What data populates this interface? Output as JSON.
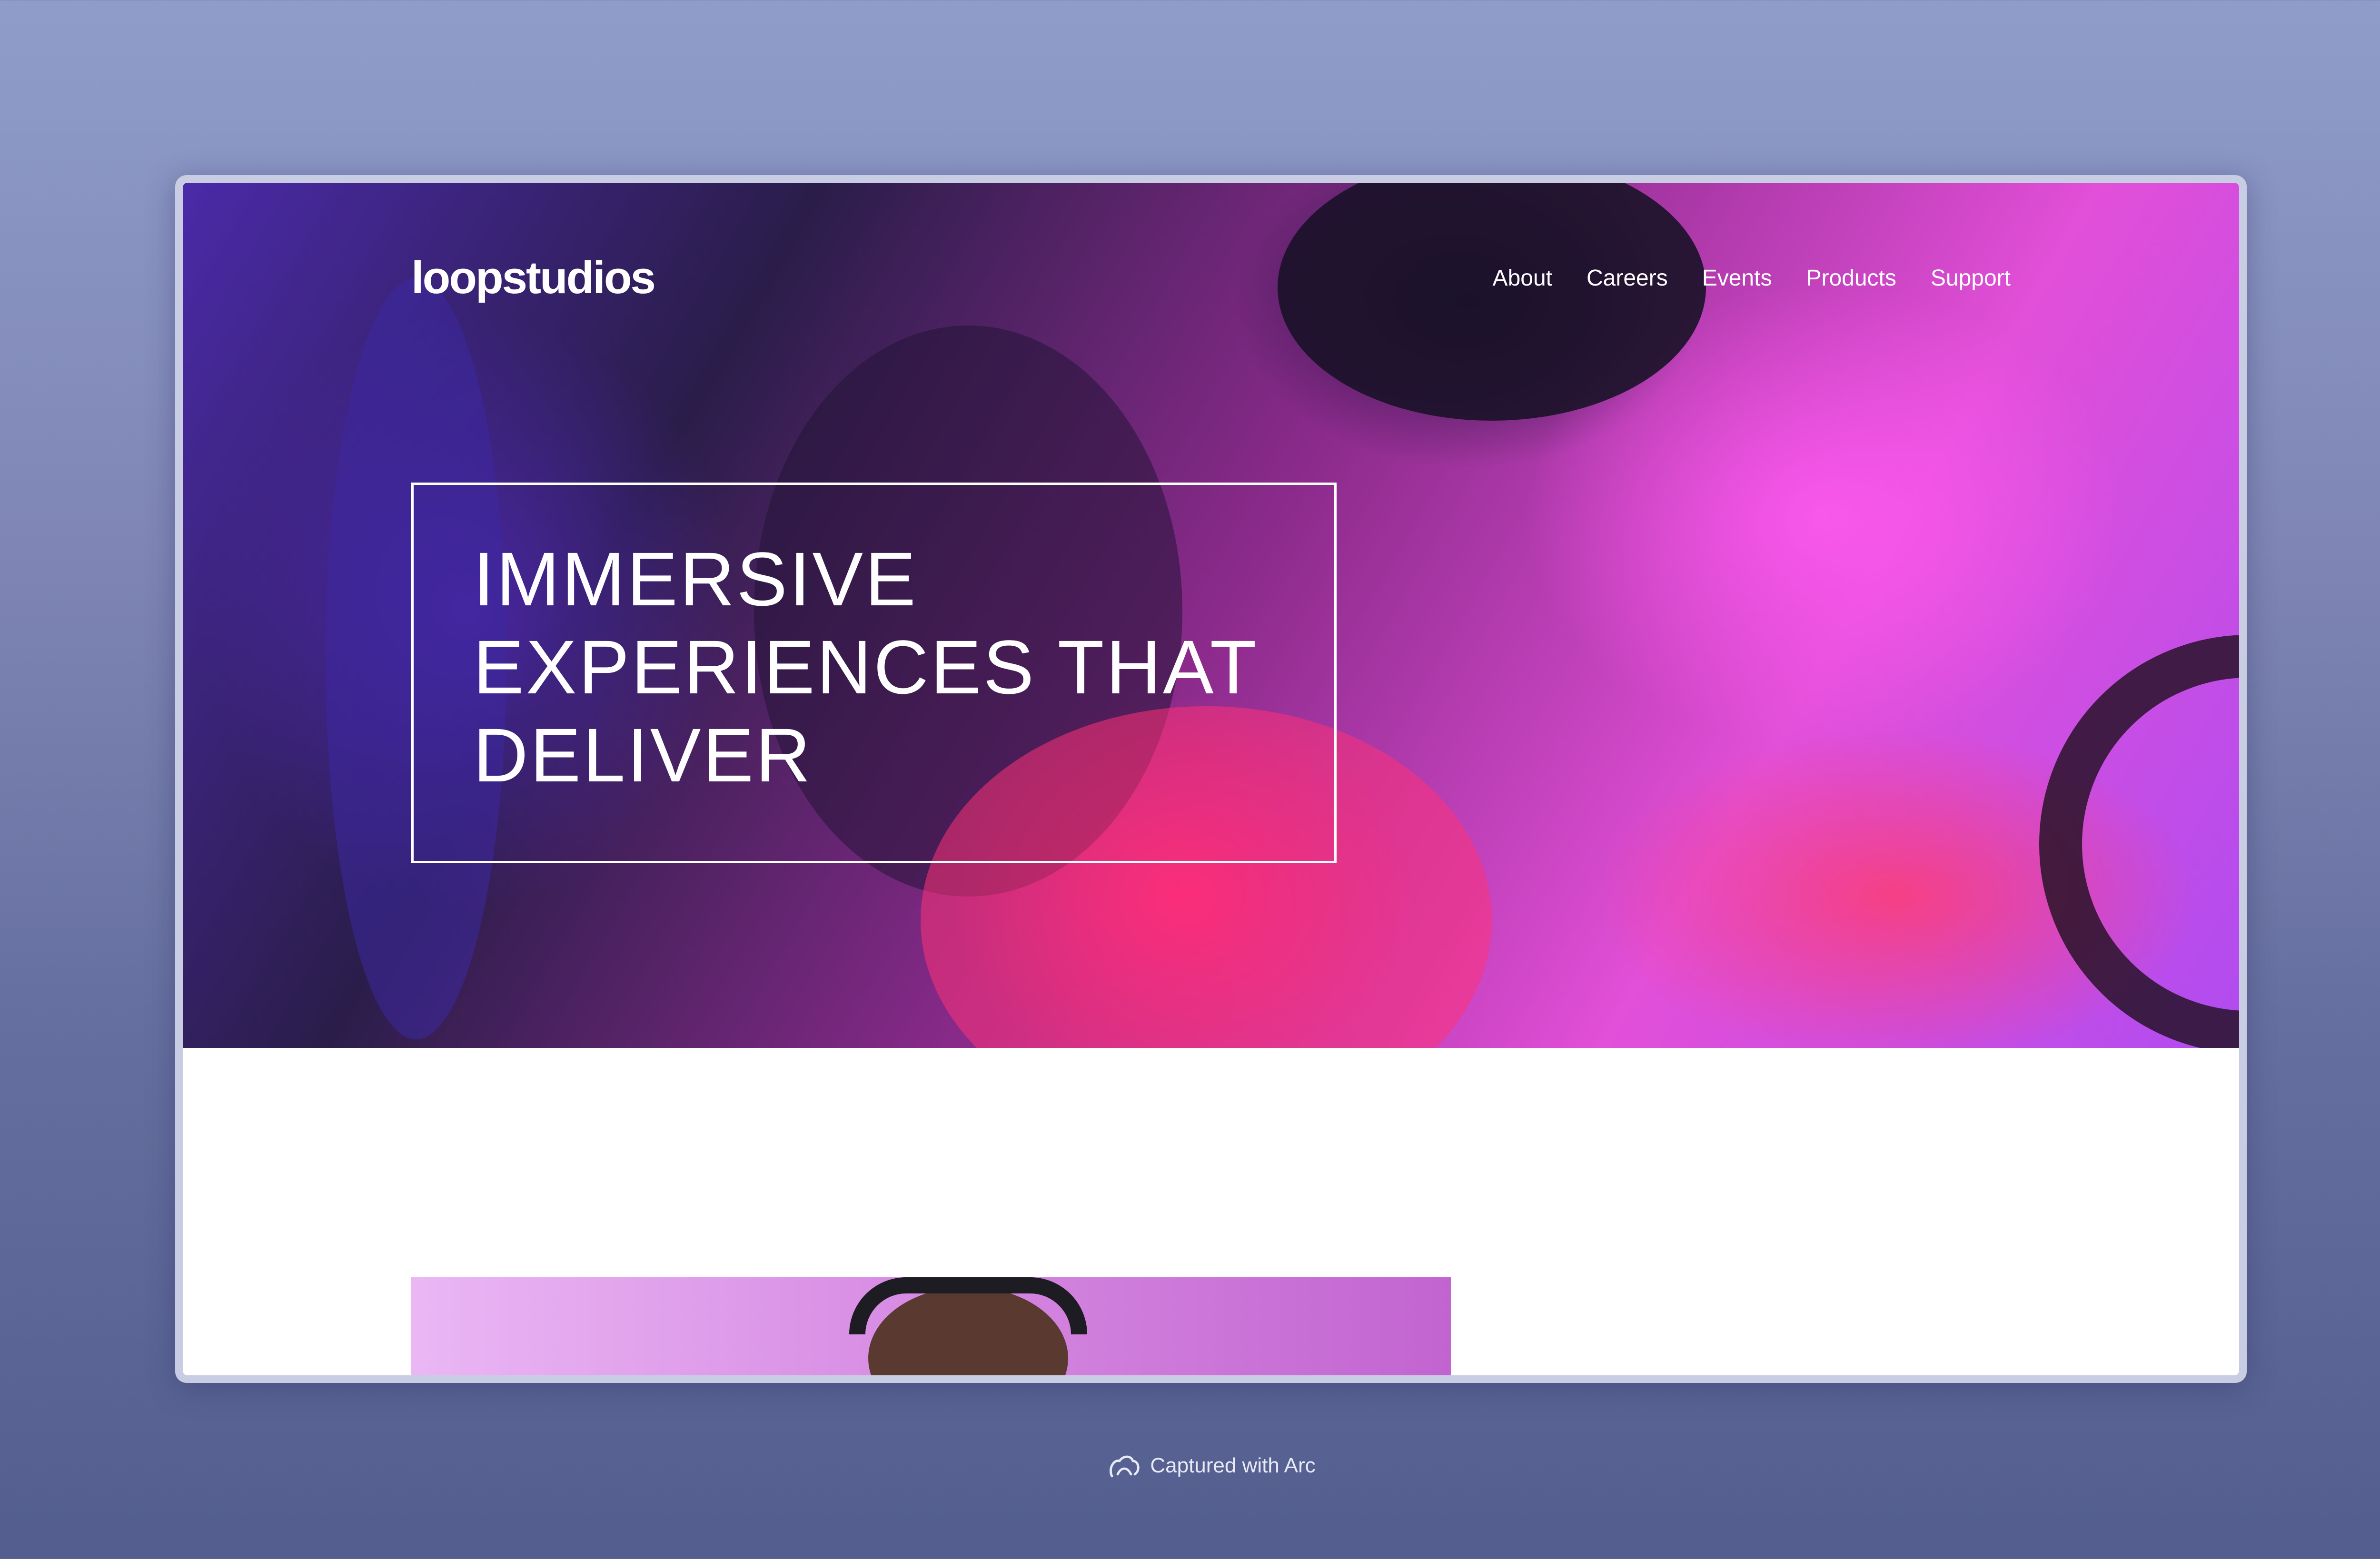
{
  "site": {
    "logo": "loopstudios",
    "nav": [
      "About",
      "Careers",
      "Events",
      "Products",
      "Support"
    ],
    "headline": "IMMERSIVE\nEXPERIENCES THAT\nDELIVER"
  },
  "footer": {
    "captured": "Captured with Arc"
  }
}
